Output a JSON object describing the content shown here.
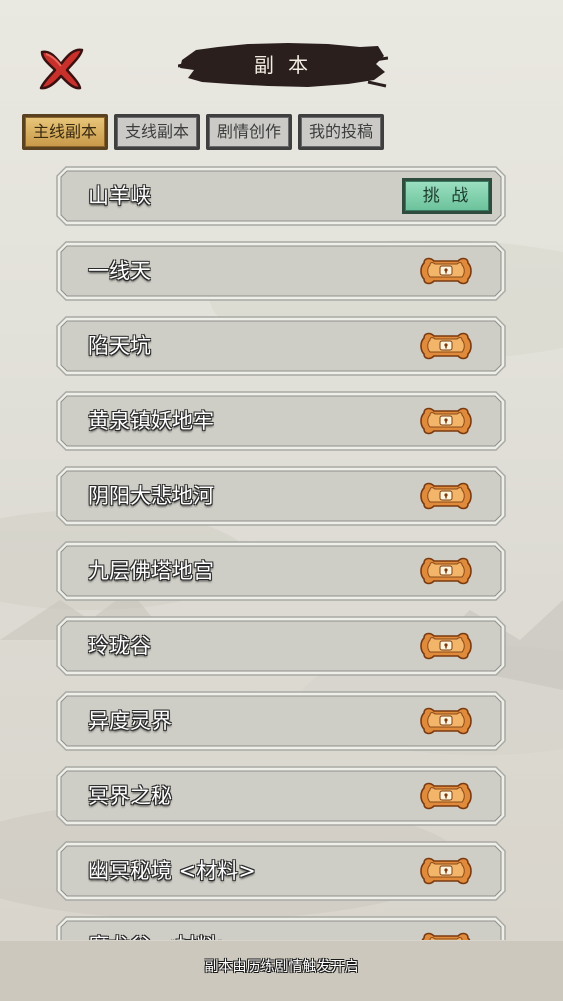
{
  "header": {
    "title": "副 本",
    "close_icon": "close-x-icon",
    "colors": {
      "close": "#c8312b",
      "banner": "#2a1f1d"
    }
  },
  "tabs": [
    {
      "label": "主线副本",
      "active": true
    },
    {
      "label": "支线副本",
      "active": false
    },
    {
      "label": "剧情创作",
      "active": false
    },
    {
      "label": "我的投稿",
      "active": false
    }
  ],
  "dungeons": [
    {
      "name": "山羊峡",
      "state": "challenge",
      "action_label": "挑 战"
    },
    {
      "name": "一线天",
      "state": "locked"
    },
    {
      "name": "陷天坑",
      "state": "locked"
    },
    {
      "name": "黄泉镇妖地牢",
      "state": "locked"
    },
    {
      "name": "阴阳大悲地河",
      "state": "locked"
    },
    {
      "name": "九层佛塔地宫",
      "state": "locked"
    },
    {
      "name": "玲珑谷",
      "state": "locked"
    },
    {
      "name": "异度灵界",
      "state": "locked"
    },
    {
      "name": "冥界之秘",
      "state": "locked"
    },
    {
      "name": "幽冥秘境 <材料>",
      "state": "locked"
    },
    {
      "name": "魔龙谷 <材料>",
      "state": "locked"
    }
  ],
  "footer": {
    "text": "副本由历练剧情触发开启"
  },
  "colors": {
    "tab_active": "#d9b062",
    "challenge_button": "#86d2b0",
    "lock_icon": "#e08a3c"
  }
}
